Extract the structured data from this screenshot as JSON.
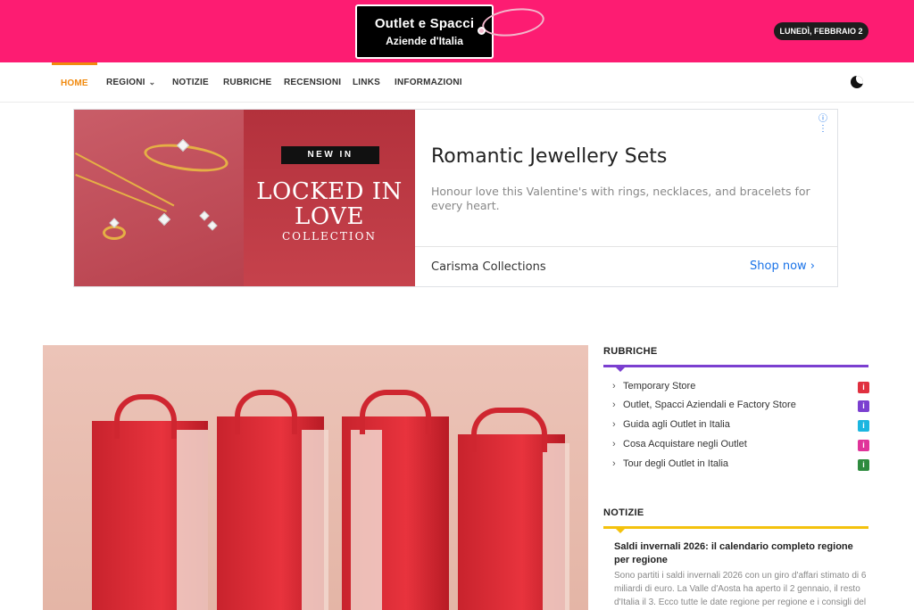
{
  "header": {
    "logo_line1": "Outlet e Spacci",
    "logo_line2": "Aziende d'Italia",
    "date": "LUNEDÌ, FEBBRAIO 2",
    "brand_color": "#fd1c72"
  },
  "nav": {
    "items": [
      {
        "label": "HOME",
        "active": true
      },
      {
        "label": "REGIONI",
        "has_dropdown": true
      },
      {
        "label": "NOTIZIE"
      },
      {
        "label": "RUBRICHE"
      },
      {
        "label": "RECENSIONI"
      },
      {
        "label": "LINKS"
      },
      {
        "label": "INFORMAZIONI"
      }
    ],
    "active_color": "#f18a0e",
    "dark_mode_icon": "moon-icon"
  },
  "ad": {
    "image_badge": "NEW IN",
    "image_title": "LOCKED IN LOVE",
    "image_subtitle": "COLLECTION",
    "headline": "Romantic Jewellery Sets",
    "description": "Honour love this Valentine's with rings, necklaces, and bracelets for every heart.",
    "advertiser": "Carisma Collections",
    "cta": "Shop now",
    "info_icon": "adchoices-icon"
  },
  "sidebar": {
    "rubriche": {
      "title": "RUBRICHE",
      "accent": "#7b3fd0",
      "items": [
        {
          "label": "Temporary Store",
          "badge_color": "#e0303f"
        },
        {
          "label": "Outlet, Spacci Aziendali e Factory Store",
          "badge_color": "#7b3fd0"
        },
        {
          "label": "Guida agli Outlet in Italia",
          "badge_color": "#1bb6e0"
        },
        {
          "label": "Cosa Acquistare negli Outlet",
          "badge_color": "#e0339a"
        },
        {
          "label": "Tour degli Outlet in Italia",
          "badge_color": "#2e8b3e"
        }
      ]
    },
    "notizie": {
      "title": "NOTIZIE",
      "accent": "#f4c20d",
      "article_title": "Saldi invernali 2026: il calendario completo regione per regione",
      "article_excerpt": "Sono partiti i saldi invernali 2026 con un giro d'affari stimato di 6 miliardi di euro. La Valle d'Aosta ha aperto il 2 gennaio, il resto d'Italia il 3. Ecco tutte le date regione per regione e i consigli del"
    }
  }
}
